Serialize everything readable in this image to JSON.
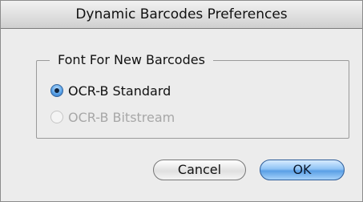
{
  "window": {
    "title": "Dynamic Barcodes Preferences"
  },
  "font_group": {
    "legend": "Font For New Barcodes",
    "options": [
      {
        "label": "OCR-B Standard",
        "selected": true,
        "enabled": true
      },
      {
        "label": "OCR-B Bitstream",
        "selected": false,
        "enabled": false
      }
    ]
  },
  "buttons": {
    "cancel_label": "Cancel",
    "ok_label": "OK"
  },
  "colors": {
    "dialog_background": "#ececec",
    "default_button": "#5a9fe6",
    "disabled_text": "#a7a7a7"
  }
}
